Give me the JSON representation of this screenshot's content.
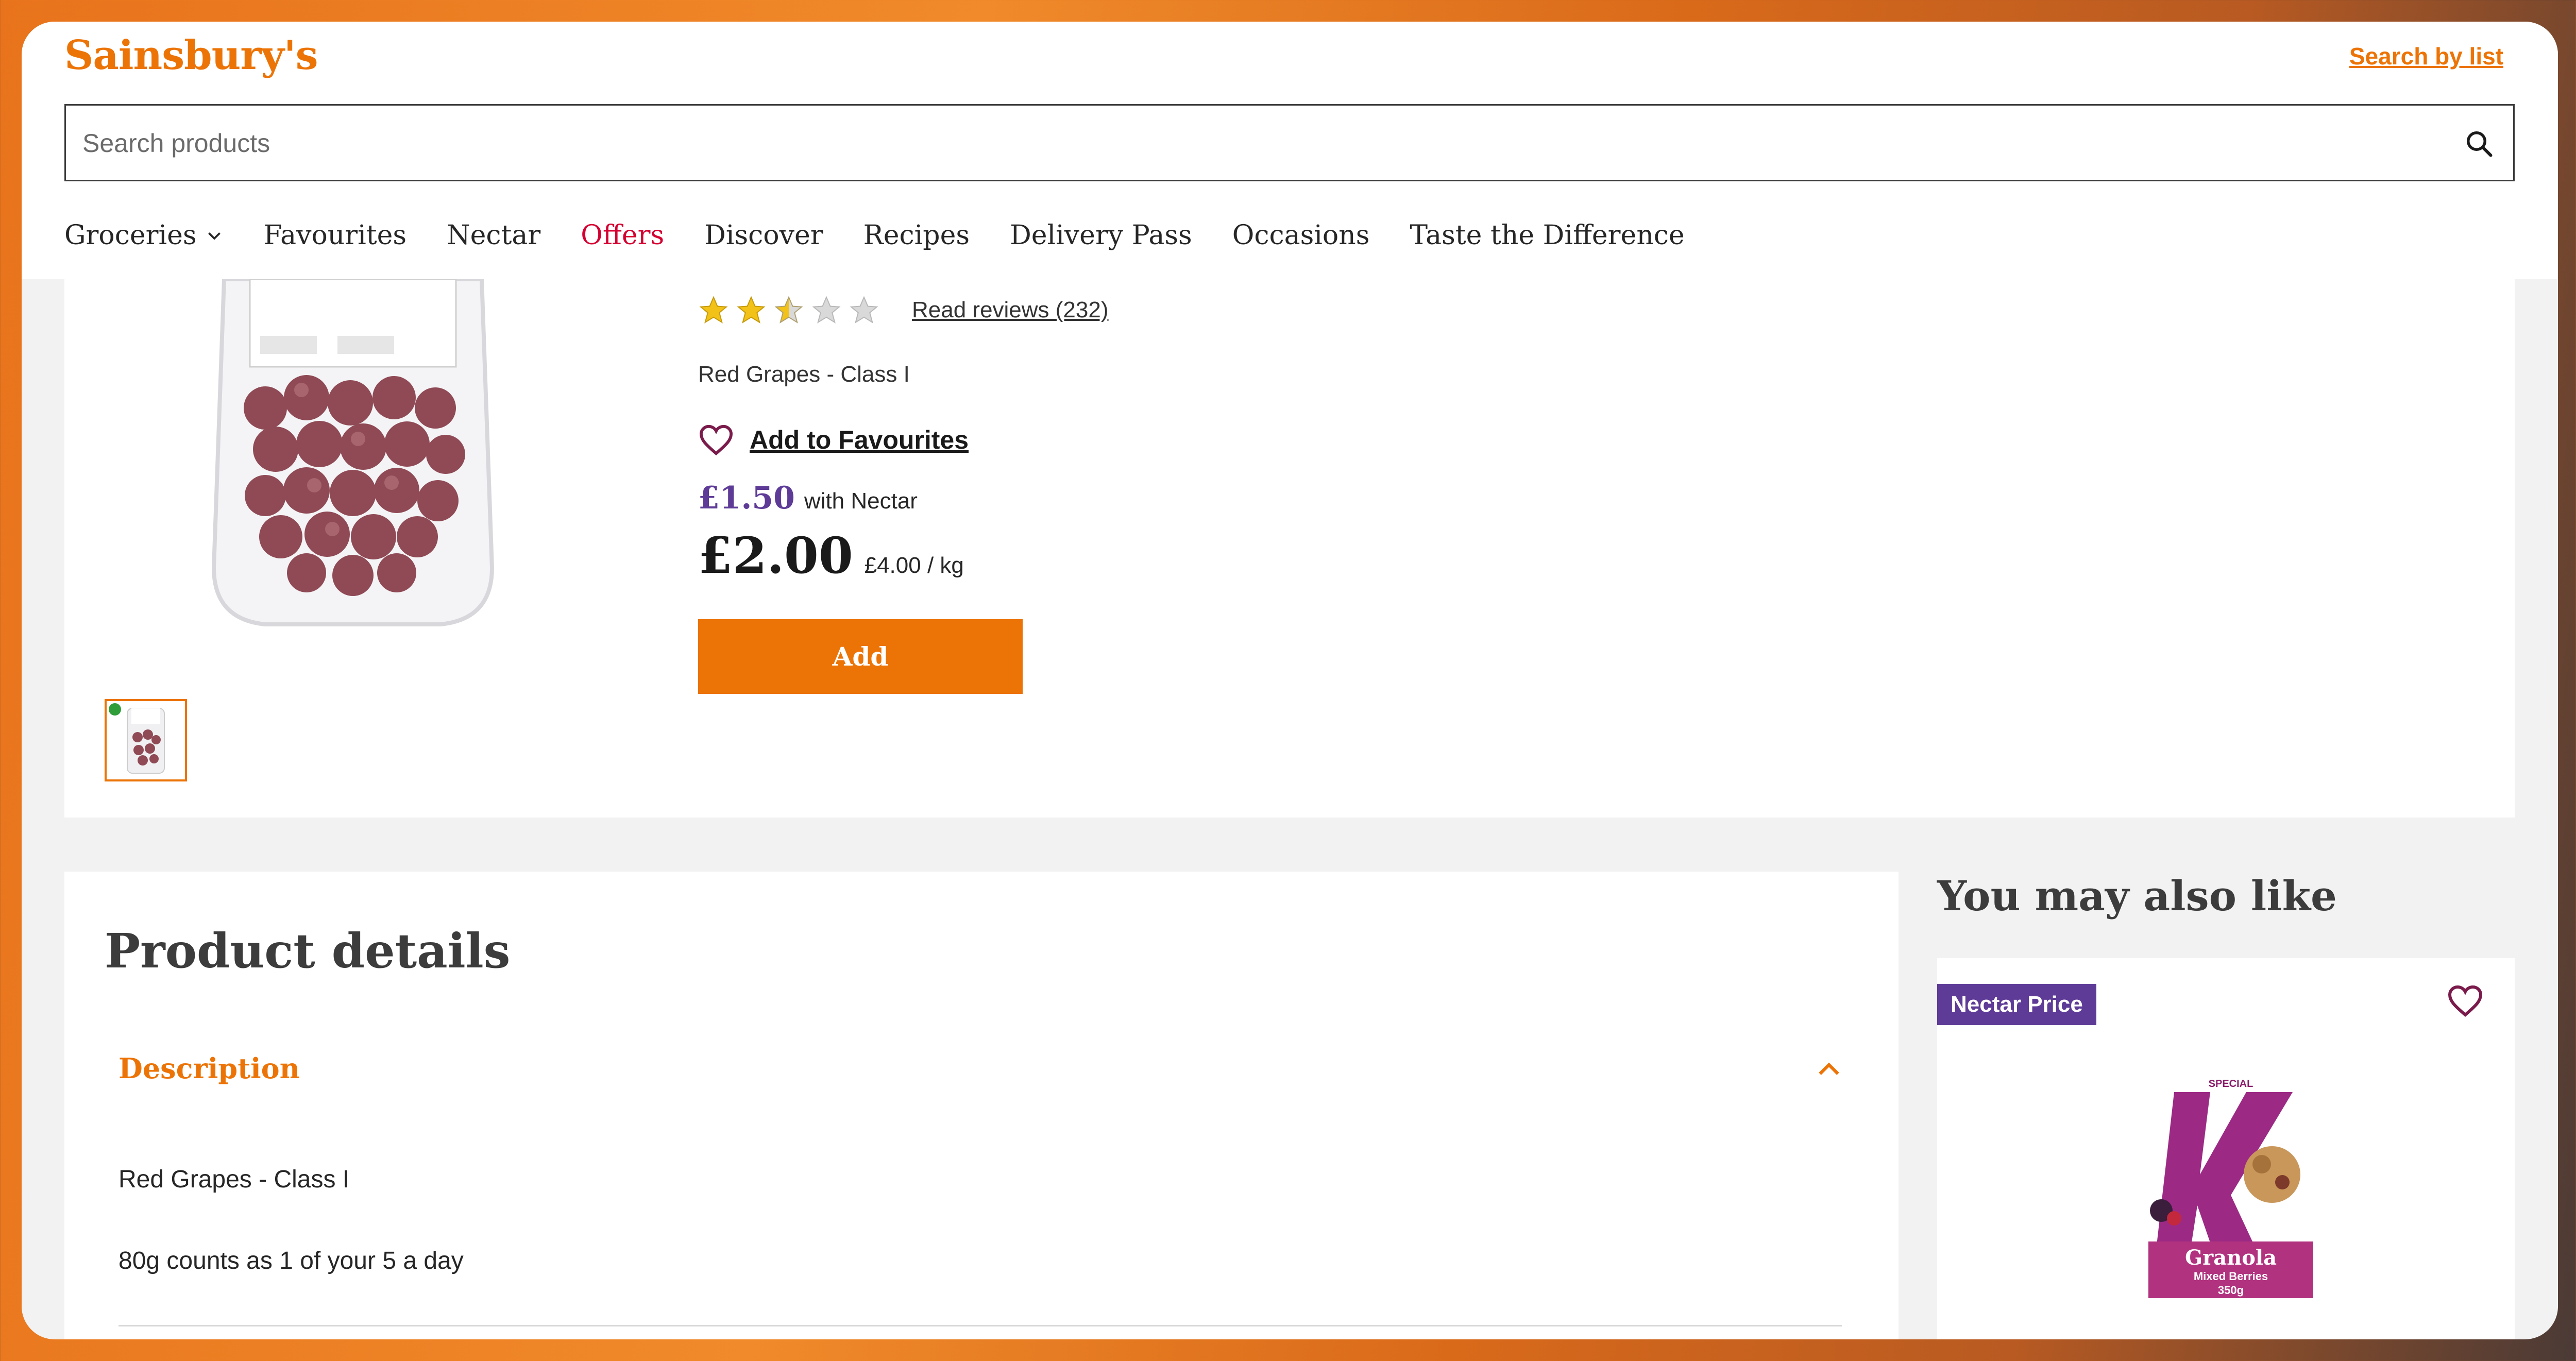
{
  "header": {
    "logo": "Sainsbury's",
    "search_by_list": "Search by list",
    "search_placeholder": "Search products"
  },
  "nav": {
    "items": [
      {
        "label": "Groceries"
      },
      {
        "label": "Favourites"
      },
      {
        "label": "Nectar"
      },
      {
        "label": "Offers"
      },
      {
        "label": "Discover"
      },
      {
        "label": "Recipes"
      },
      {
        "label": "Delivery Pass"
      },
      {
        "label": "Occasions"
      },
      {
        "label": "Taste the Difference"
      }
    ]
  },
  "product": {
    "rating": 2.5,
    "reviews_label": "Read reviews (232)",
    "subtitle": "Red Grapes - Class I",
    "favourite_label": "Add to Favourites",
    "nectar_price": "£1.50",
    "nectar_text": "with Nectar",
    "price": "£2.00",
    "unit_price": "£4.00 / kg",
    "add_label": "Add"
  },
  "details": {
    "title": "Product details",
    "description_heading": "Description",
    "lines": [
      "Red Grapes - Class I",
      "80g counts as 1 of your 5 a day"
    ]
  },
  "also_like": {
    "title": "You may also like",
    "badge": "Nectar Price",
    "product_image": {
      "brand": "SPECIAL",
      "name": "Granola",
      "variant": "Mixed Berries",
      "weight": "350g"
    }
  },
  "colors": {
    "brand_orange": "#ec7407",
    "nectar_purple": "#5e3b97",
    "offers_red": "#d50032"
  }
}
